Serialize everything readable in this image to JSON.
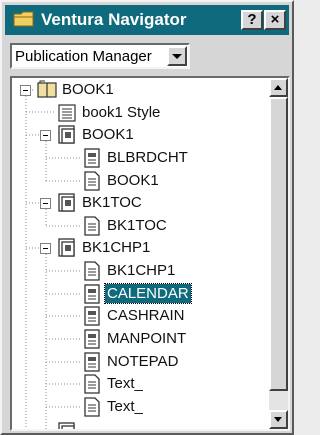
{
  "window": {
    "title": "Ventura Navigator",
    "help_button": "?",
    "close_button": "×",
    "title_color": "#0f6a7e"
  },
  "dropdown": {
    "value": "Publication Manager",
    "icon": "chevron-down-icon"
  },
  "tree": {
    "items": [
      {
        "label": "BOOK1",
        "icon": "book-icon",
        "level": 0,
        "expanded": true
      },
      {
        "label": "book1 Style",
        "icon": "style-icon",
        "level": 1
      },
      {
        "label": "BOOK1",
        "icon": "chapter-icon",
        "level": 1,
        "expanded": true
      },
      {
        "label": "BLBRDCHT",
        "icon": "file-icon",
        "level": 2
      },
      {
        "label": "BOOK1",
        "icon": "text-file-icon",
        "level": 2
      },
      {
        "label": "BK1TOC",
        "icon": "chapter-icon",
        "level": 1,
        "expanded": true
      },
      {
        "label": "BK1TOC",
        "icon": "text-file-icon",
        "level": 2
      },
      {
        "label": "BK1CHP1",
        "icon": "chapter-icon",
        "level": 1,
        "expanded": true
      },
      {
        "label": "BK1CHP1",
        "icon": "text-file-icon",
        "level": 2
      },
      {
        "label": "CALENDAR",
        "icon": "file-icon",
        "level": 2,
        "selected": true
      },
      {
        "label": "CASHRAIN",
        "icon": "file-icon",
        "level": 2
      },
      {
        "label": "MANPOINT",
        "icon": "file-icon",
        "level": 2
      },
      {
        "label": "NOTEPAD",
        "icon": "file-icon",
        "level": 2
      },
      {
        "label": "Text_",
        "icon": "text-file-icon",
        "level": 2
      },
      {
        "label": "Text_",
        "icon": "text-file-icon",
        "level": 2
      }
    ]
  }
}
